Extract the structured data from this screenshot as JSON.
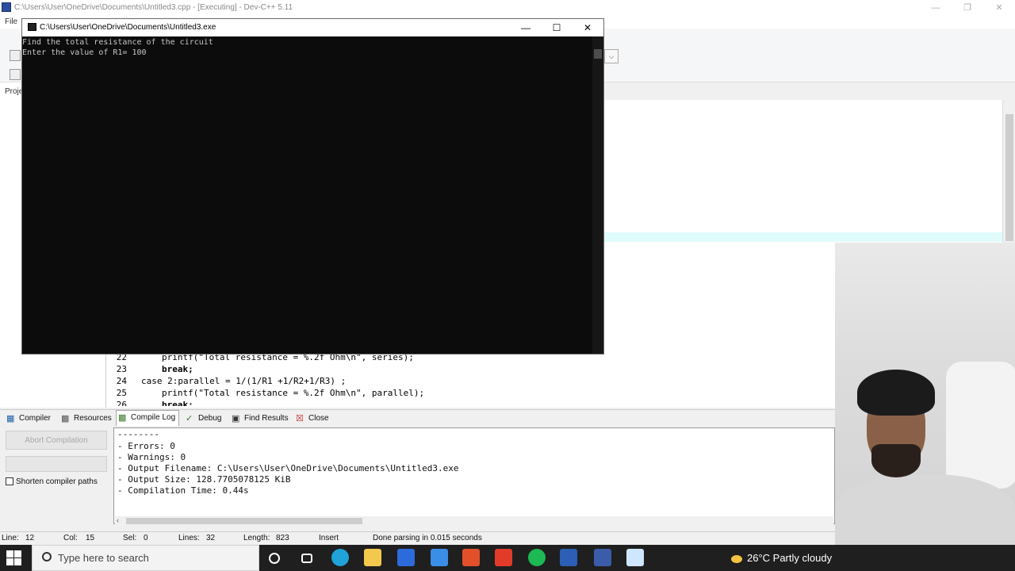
{
  "main_window": {
    "title": "C:\\Users\\User\\OneDrive\\Documents\\Untitled3.cpp - [Executing] - Dev-C++ 5.11",
    "menu_file": "File",
    "project_tab": "Proje",
    "controls": {
      "minimize": "—",
      "restore": "❐",
      "close": "✕"
    }
  },
  "editor": {
    "lines": [
      {
        "num": "22",
        "code": "printf(\"Total resistance = %.2f Ohm\\n\", series);"
      },
      {
        "num": "23",
        "code": "break;"
      },
      {
        "num": "24",
        "code": "case 2:parallel = 1/(1/R1 +1/R2+1/R3) ;"
      },
      {
        "num": "25",
        "code": "printf(\"Total resistance = %.2f Ohm\\n\", parallel);"
      },
      {
        "num": "26",
        "code": "break;"
      }
    ]
  },
  "bottom_tabs": [
    {
      "label": "Compiler",
      "icon": "grid-icon"
    },
    {
      "label": "Resources",
      "icon": "resources-icon"
    },
    {
      "label": "Compile Log",
      "icon": "chart-icon"
    },
    {
      "label": "Debug",
      "icon": "check-icon"
    },
    {
      "label": "Find Results",
      "icon": "find-icon"
    },
    {
      "label": "Close",
      "icon": "close-icon"
    }
  ],
  "compiler_panel": {
    "abort_label": "Abort Compilation",
    "shorten_label": "Shorten compiler paths",
    "log": [
      "--------",
      "- Errors: 0",
      "- Warnings: 0",
      "- Output Filename: C:\\Users\\User\\OneDrive\\Documents\\Untitled3.exe",
      "- Output Size: 128.7705078125 KiB",
      "- Compilation Time: 0.44s"
    ]
  },
  "status": {
    "line_label": "Line:",
    "line": "12",
    "col_label": "Col:",
    "col": "15",
    "sel_label": "Sel:",
    "sel": "0",
    "lines_label": "Lines:",
    "lines": "32",
    "length_label": "Length:",
    "length": "823",
    "mode": "Insert",
    "message": "Done parsing in 0.015 seconds"
  },
  "console": {
    "title": "C:\\Users\\User\\OneDrive\\Documents\\Untitled3.exe",
    "output": [
      "Find the total resistance of the circuit",
      "Enter the value of R1= 100"
    ],
    "controls": {
      "minimize": "—",
      "maximize": "☐",
      "close": "✕"
    }
  },
  "taskbar": {
    "search_placeholder": "Type here to search",
    "weather": "26°C  Partly cloudy",
    "apps": [
      {
        "name": "cortana-icon",
        "color": "#ffffff"
      },
      {
        "name": "task-view-icon",
        "color": "#ffffff"
      },
      {
        "name": "edge-icon",
        "color": "#1fa3d8"
      },
      {
        "name": "file-explorer-icon",
        "color": "#f2c94c"
      },
      {
        "name": "code-app-icon",
        "color": "#2d6bdd"
      },
      {
        "name": "mail-icon",
        "color": "#3a8ee6"
      },
      {
        "name": "office-icon",
        "color": "#e2502a"
      },
      {
        "name": "red-app-icon",
        "color": "#e23b2a"
      },
      {
        "name": "spotify-icon",
        "color": "#1db954"
      },
      {
        "name": "word-icon",
        "color": "#2b5eb4"
      },
      {
        "name": "devcpp-icon",
        "color": "#3b5ca8"
      },
      {
        "name": "console-app-icon",
        "color": "#cfe6ff"
      }
    ]
  }
}
